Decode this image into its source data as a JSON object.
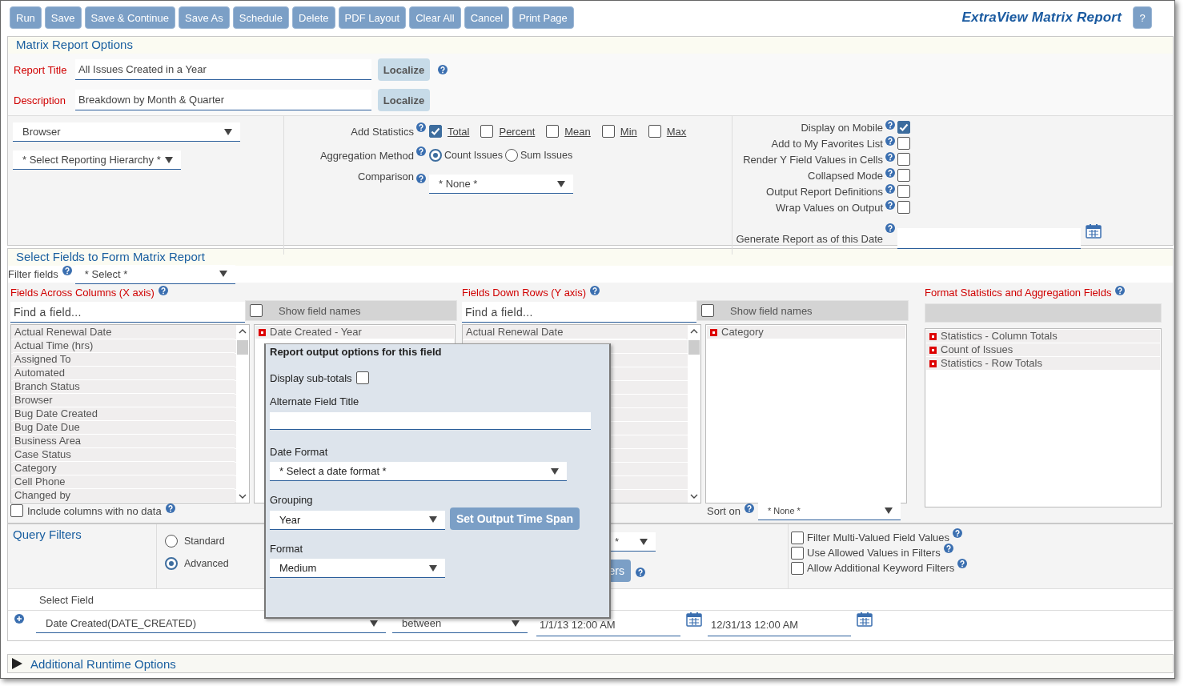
{
  "toolbar": {
    "buttons": [
      "Run",
      "Save",
      "Save & Continue",
      "Save As",
      "Schedule",
      "Delete",
      "PDF Layout",
      "Clear All",
      "Cancel",
      "Print Page"
    ],
    "title": "ExtraView Matrix Report",
    "help_button": "?"
  },
  "options": {
    "heading": "Matrix Report Options",
    "title_field": {
      "label": "Report Title",
      "value": "All Issues Created in a Year",
      "button": "Localize"
    },
    "description_field": {
      "label": "Description",
      "value": "Breakdown by Month & Quarter",
      "button": "Localize"
    },
    "browser_select": "Browser",
    "hierarchy_select": "* Select Reporting Hierarchy *",
    "add_statistics": {
      "label": "Add Statistics",
      "items": [
        {
          "label": "Total",
          "checked": true
        },
        {
          "label": "Percent",
          "checked": false
        },
        {
          "label": "Mean",
          "checked": false
        },
        {
          "label": "Min",
          "checked": false
        },
        {
          "label": "Max",
          "checked": false
        }
      ]
    },
    "aggregation": {
      "label": "Aggregation Method",
      "options": [
        {
          "label": "Count Issues",
          "selected": true
        },
        {
          "label": "Sum Issues",
          "selected": false
        }
      ]
    },
    "comparison": {
      "label": "Comparison",
      "value": "* None *"
    },
    "flags": [
      {
        "label": "Display on Mobile",
        "checked": true
      },
      {
        "label": "Add to My Favorites List",
        "checked": false
      },
      {
        "label": "Render Y Field Values in Cells",
        "checked": false
      },
      {
        "label": "Collapsed Mode",
        "checked": false
      },
      {
        "label": "Output Report Definitions",
        "checked": false
      },
      {
        "label": "Wrap Values on Output",
        "checked": false
      }
    ],
    "as_of_date": {
      "label": "Generate Report as of this Date"
    }
  },
  "fields": {
    "heading": "Select Fields to Form Matrix Report",
    "filter": {
      "label": "Filter fields",
      "value": "* Select *"
    },
    "x_axis": {
      "heading": "Fields Across Columns (X axis)",
      "search_placeholder": "Find a field...",
      "show_names": {
        "label": "Show field names",
        "checked": false
      },
      "available": [
        "Actual Renewal Date",
        "Actual Time (hrs)",
        "Assigned To",
        "Automated",
        "Branch Status",
        "Browser",
        "Bug Date Created",
        "Bug Date Due",
        "Business Area",
        "Case Status",
        "Category",
        "Cell Phone",
        "Changed by"
      ],
      "selected": [
        "Date Created - Year"
      ],
      "include_empty": {
        "label": "Include columns with no data",
        "checked": false
      }
    },
    "y_axis": {
      "heading": "Fields Down Rows (Y axis)",
      "search_placeholder": "Find a field...",
      "show_names": {
        "label": "Show field names",
        "checked": false
      },
      "available": [
        "Actual Renewal Date"
      ],
      "selected": [
        "Category"
      ],
      "sort": {
        "label": "Sort on",
        "value": "* None *"
      }
    },
    "format": {
      "heading": "Format Statistics and Aggregation Fields",
      "selected": [
        "Statistics - Column Totals",
        "Count of Issues",
        "Statistics - Row Totals"
      ]
    }
  },
  "query_filters": {
    "heading": "Query Filters",
    "modes": [
      {
        "label": "Standard",
        "selected": false
      },
      {
        "label": "Advanced",
        "selected": true
      }
    ],
    "partial_select": "*",
    "partial_button": "ers",
    "options": [
      {
        "label": "Filter Multi-Valued Field Values",
        "checked": false
      },
      {
        "label": "Use Allowed Values in Filters",
        "checked": false
      },
      {
        "label": "Allow Additional Keyword Filters",
        "checked": false
      }
    ],
    "select_field_label": "Select Field",
    "filter_row": {
      "field": "Date Created(DATE_CREATED)",
      "operator": "between",
      "from": "1/1/13 12:00 AM",
      "to": "12/31/13 12:00 AM"
    }
  },
  "runtime": {
    "label": "Additional Runtime Options",
    "expanded": false
  },
  "popup": {
    "title": "Report output options for this field",
    "subtotals": {
      "label": "Display sub-totals",
      "checked": false
    },
    "alt_title": {
      "label": "Alternate Field Title"
    },
    "date_format": {
      "label": "Date Format",
      "value": "* Select a date format *"
    },
    "grouping": {
      "label": "Grouping",
      "value": "Year",
      "button": "Set Output Time Span"
    },
    "format": {
      "label": "Format",
      "value": "Medium"
    }
  }
}
